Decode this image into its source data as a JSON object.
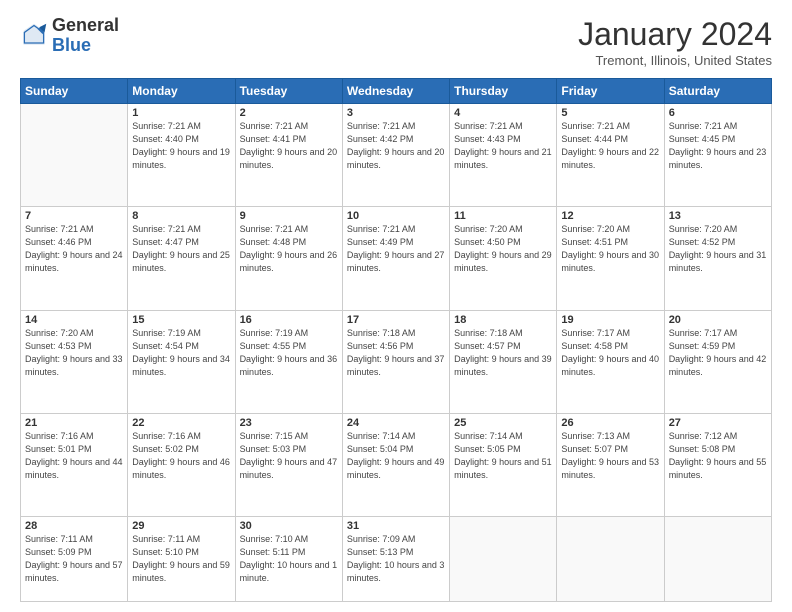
{
  "header": {
    "logo_general": "General",
    "logo_blue": "Blue",
    "month_title": "January 2024",
    "subtitle": "Tremont, Illinois, United States"
  },
  "days_of_week": [
    "Sunday",
    "Monday",
    "Tuesday",
    "Wednesday",
    "Thursday",
    "Friday",
    "Saturday"
  ],
  "weeks": [
    [
      {
        "day": "",
        "sunrise": "",
        "sunset": "",
        "daylight": ""
      },
      {
        "day": "1",
        "sunrise": "7:21 AM",
        "sunset": "4:40 PM",
        "daylight": "9 hours and 19 minutes."
      },
      {
        "day": "2",
        "sunrise": "7:21 AM",
        "sunset": "4:41 PM",
        "daylight": "9 hours and 20 minutes."
      },
      {
        "day": "3",
        "sunrise": "7:21 AM",
        "sunset": "4:42 PM",
        "daylight": "9 hours and 20 minutes."
      },
      {
        "day": "4",
        "sunrise": "7:21 AM",
        "sunset": "4:43 PM",
        "daylight": "9 hours and 21 minutes."
      },
      {
        "day": "5",
        "sunrise": "7:21 AM",
        "sunset": "4:44 PM",
        "daylight": "9 hours and 22 minutes."
      },
      {
        "day": "6",
        "sunrise": "7:21 AM",
        "sunset": "4:45 PM",
        "daylight": "9 hours and 23 minutes."
      }
    ],
    [
      {
        "day": "7",
        "sunrise": "7:21 AM",
        "sunset": "4:46 PM",
        "daylight": "9 hours and 24 minutes."
      },
      {
        "day": "8",
        "sunrise": "7:21 AM",
        "sunset": "4:47 PM",
        "daylight": "9 hours and 25 minutes."
      },
      {
        "day": "9",
        "sunrise": "7:21 AM",
        "sunset": "4:48 PM",
        "daylight": "9 hours and 26 minutes."
      },
      {
        "day": "10",
        "sunrise": "7:21 AM",
        "sunset": "4:49 PM",
        "daylight": "9 hours and 27 minutes."
      },
      {
        "day": "11",
        "sunrise": "7:20 AM",
        "sunset": "4:50 PM",
        "daylight": "9 hours and 29 minutes."
      },
      {
        "day": "12",
        "sunrise": "7:20 AM",
        "sunset": "4:51 PM",
        "daylight": "9 hours and 30 minutes."
      },
      {
        "day": "13",
        "sunrise": "7:20 AM",
        "sunset": "4:52 PM",
        "daylight": "9 hours and 31 minutes."
      }
    ],
    [
      {
        "day": "14",
        "sunrise": "7:20 AM",
        "sunset": "4:53 PM",
        "daylight": "9 hours and 33 minutes."
      },
      {
        "day": "15",
        "sunrise": "7:19 AM",
        "sunset": "4:54 PM",
        "daylight": "9 hours and 34 minutes."
      },
      {
        "day": "16",
        "sunrise": "7:19 AM",
        "sunset": "4:55 PM",
        "daylight": "9 hours and 36 minutes."
      },
      {
        "day": "17",
        "sunrise": "7:18 AM",
        "sunset": "4:56 PM",
        "daylight": "9 hours and 37 minutes."
      },
      {
        "day": "18",
        "sunrise": "7:18 AM",
        "sunset": "4:57 PM",
        "daylight": "9 hours and 39 minutes."
      },
      {
        "day": "19",
        "sunrise": "7:17 AM",
        "sunset": "4:58 PM",
        "daylight": "9 hours and 40 minutes."
      },
      {
        "day": "20",
        "sunrise": "7:17 AM",
        "sunset": "4:59 PM",
        "daylight": "9 hours and 42 minutes."
      }
    ],
    [
      {
        "day": "21",
        "sunrise": "7:16 AM",
        "sunset": "5:01 PM",
        "daylight": "9 hours and 44 minutes."
      },
      {
        "day": "22",
        "sunrise": "7:16 AM",
        "sunset": "5:02 PM",
        "daylight": "9 hours and 46 minutes."
      },
      {
        "day": "23",
        "sunrise": "7:15 AM",
        "sunset": "5:03 PM",
        "daylight": "9 hours and 47 minutes."
      },
      {
        "day": "24",
        "sunrise": "7:14 AM",
        "sunset": "5:04 PM",
        "daylight": "9 hours and 49 minutes."
      },
      {
        "day": "25",
        "sunrise": "7:14 AM",
        "sunset": "5:05 PM",
        "daylight": "9 hours and 51 minutes."
      },
      {
        "day": "26",
        "sunrise": "7:13 AM",
        "sunset": "5:07 PM",
        "daylight": "9 hours and 53 minutes."
      },
      {
        "day": "27",
        "sunrise": "7:12 AM",
        "sunset": "5:08 PM",
        "daylight": "9 hours and 55 minutes."
      }
    ],
    [
      {
        "day": "28",
        "sunrise": "7:11 AM",
        "sunset": "5:09 PM",
        "daylight": "9 hours and 57 minutes."
      },
      {
        "day": "29",
        "sunrise": "7:11 AM",
        "sunset": "5:10 PM",
        "daylight": "9 hours and 59 minutes."
      },
      {
        "day": "30",
        "sunrise": "7:10 AM",
        "sunset": "5:11 PM",
        "daylight": "10 hours and 1 minute."
      },
      {
        "day": "31",
        "sunrise": "7:09 AM",
        "sunset": "5:13 PM",
        "daylight": "10 hours and 3 minutes."
      },
      {
        "day": "",
        "sunrise": "",
        "sunset": "",
        "daylight": ""
      },
      {
        "day": "",
        "sunrise": "",
        "sunset": "",
        "daylight": ""
      },
      {
        "day": "",
        "sunrise": "",
        "sunset": "",
        "daylight": ""
      }
    ]
  ]
}
